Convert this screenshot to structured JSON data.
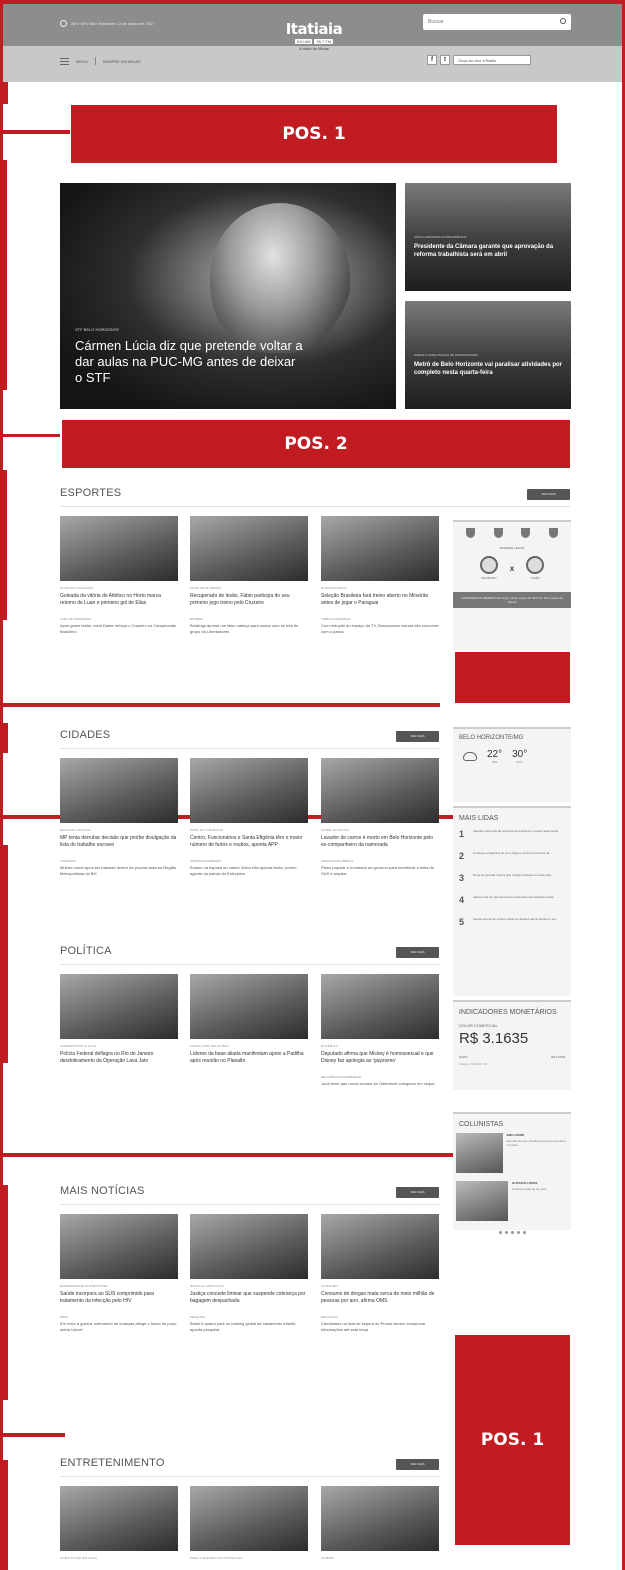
{
  "header": {
    "weather_text": "28°c 18°c Belo Horizonte 13 de março de 2017",
    "logo_name": "Itatiaia",
    "logo_freq_am": "610 AM",
    "logo_freq_fm": "95.7 FM",
    "logo_tagline": "A rádio de Minas",
    "search_placeholder": "Buscar",
    "menu_label": "MENU",
    "menu_link": "SEMPRE EM MINAS",
    "listen_label": "Ouça ao vivo a Rádio"
  },
  "ads": {
    "pos1_top": "POS. 1",
    "pos2": "POS. 2",
    "pos1_bottom": "POS. 1"
  },
  "hero": {
    "main_category": "STF BELO HORIZONTE",
    "main_title": "Cármen Lúcia diz que pretende voltar a dar aulas na PUC-MG antes de deixar o STF",
    "side": [
      {
        "category": "APÓS A REFORMA DA PREVIDÊNCIA",
        "title": "Presidente da Câmara garante que aprovação da reforma trabalhista será em abril"
      },
      {
        "category": "GREVE E PARALISAÇÃO DE PROFESSORES",
        "title": "Metrô de Belo Horizonte vai paralisar atividades por completo nesta quarta-feira"
      }
    ]
  },
  "esportes": {
    "title": "ESPORTES",
    "more": "VER MAIS",
    "cards": [
      {
        "cat": "ATLÉTICO GOLEADA",
        "title": "Goleada da vitória do Atlético no Horto marca retorno de Luan e primeiro gol de Elias",
        "cat2": "FLAG DE TRANSIÇÃO",
        "sub": "Após grave lesão, meia Dante reforça o Cruzeiro no Campeonato Brasileiro"
      },
      {
        "cat": "APÓS SETE MESES",
        "title": "Recuperado de lesão, Fábio participa do seu primeiro jogo treino pelo Cruzeiro",
        "cat2": "ESTREIA",
        "sub": "Botafogo aponta um falso cabeça para somar com os três do grupo da Libertadores"
      },
      {
        "cat": "ELIMINATÓRIAS",
        "title": "Seleção Brasileira fará treino aberto no Mineirão antes de jogar o Paraguai",
        "cat2": "TEMPO E MUDANÇA",
        "sub": "Com redução do espaço da TV, Bonsucesso estuda não concorrer com o passo"
      }
    ]
  },
  "cidades": {
    "title": "CIDADES",
    "more": "VER MAIS",
    "cards": [
      {
        "cat": "BARALHA JUDICIAL",
        "title": "MP tenta derrubar decisão que proíbe divulgação da lista do trabalho escravo",
        "cat2": "VIOLÊNCIA",
        "sub": "Mulher morre após ser baleada dentro da própria casa na Região Metropolitana de BH"
      },
      {
        "cat": "MAPA DA VIOLÊNCIA",
        "title": "Centro, Funcionários e Santa Efigênia têm o maior número de furtos e roubos, aponta APP",
        "cat2": "SUPOSTA AGRESSÃO",
        "sub": "Exame na esposa do cantor Victor não aponta lesão, porém agente da polícia do Entrepôvo"
      },
      {
        "cat": "CRIME NA DIVISA",
        "title": "Lavador de carros é morto em Belo Horizonte pelo ex-companheiro da namorada",
        "cat2": "ASSOCIAÇÃO MÉDICA",
        "sub": "Plano popular é mostrado ao governo para beneficiar a linha do SUS e ampliar"
      }
    ]
  },
  "politica": {
    "title": "POLÍTICA",
    "more": "VER MAIS",
    "cards": [
      {
        "cat": "SUBSIDIÁRIOS E ALVO",
        "title": "Polícia Federal deflagra no Rio de Janeiro desdobramento da Operação Lava Jato"
      },
      {
        "cat": "ACENO POR DELAÇÕES",
        "title": "Líderes da base aliada manifestam apoio a Padilha após reunião no Planalto"
      },
      {
        "cat": "POLÊMICA",
        "title": "Deputado afirma que Mickey é homossexual e que Disney faz apologia ao 'gayzismo'",
        "cat2": "DELAÇÕES DA ODEBRECHT",
        "sub": "Jucá teme que novos nomes da Odebrecht coloquem em xeque"
      }
    ]
  },
  "mais_noticias": {
    "title": "MAIS NOTÍCIAS",
    "more": "VER MAIS",
    "cards": [
      {
        "cat": "ENFERMIDADE DISPENSÁVEL",
        "title": "Saúde incorpora ao SUS comprimido para tratamento da infecção pelo HIV",
        "cat2": "SÍRIA",
        "sub": "Em meio à guerra, sofrimento de crianças atinge o fundo do poço, alerta Unicef"
      },
      {
        "cat": "NAVES E HABITAÇÃO",
        "title": "Justiça concede liminar que suspende cobrança por bagagem despachada",
        "cat2": "PESQUISA",
        "sub": "Brasil é quarto país no ranking global de casamento infantil, aponta pesquisa"
      },
      {
        "cat": "CONSUMO",
        "title": "Consumo de drogas mata cerca de meio milhão de pessoas por ano, afirma OMS",
        "cat2": "EDUCAÇÃO",
        "sub": "Candidatos na lista de espera do Prouni devem comprovar informações até esta terça"
      }
    ]
  },
  "entretenimento": {
    "title": "ENTRETENIMENTO",
    "more": "VER MAIS",
    "cards": [
      {
        "cat": "COMO FICAR EM CASA"
      },
      {
        "cat": "PARA A ALEGRIA DA CRIANÇADA"
      },
      {
        "cat": "CINEMA"
      }
    ]
  },
  "sidebar": {
    "match": {
      "info": "PREMIER LEGUE",
      "team_a": "CRUZEIRO",
      "team_b": "UNIÃO",
      "vs": "x",
      "foot": "CAMPEONATO MINEIRO Domingo, 19 de março de 2017 às 16h | Arena do Jacaré"
    },
    "weather": {
      "city": "BELO HORIZONTE/MG",
      "min": "22°",
      "max": "30°",
      "min_label": "MIN",
      "max_label": "MAX"
    },
    "mais_lidas": {
      "title": "MAIS LIDAS",
      "items": [
        {
          "n": "1",
          "t": "Solução para pais de crianças com autismo é pauta nesta sexta"
        },
        {
          "n": "2",
          "t": "Conheça a trajetória do Uno antigo e Gol do pra-frente 11"
        },
        {
          "n": "3",
          "t": "Nova temporada mostra que o Itaipu destaca a nossa raça"
        },
        {
          "n": "4",
          "t": "Atleta pode ser primeira para contar tudo nas histórias a fala"
        },
        {
          "n": "5",
          "t": "Vende acenar de sonhos cada ver desde Lula no Equipo e ver"
        }
      ]
    },
    "indicadores": {
      "title": "INDICADORES MONETÁRIOS",
      "label": "DÓLAR COMERCIAL",
      "value": "R$ 3.1635",
      "euro_label": "EURO",
      "euro_value": "R$ 3.3528",
      "note": "Cotação: 13/03/2017 18h"
    },
    "colunistas": {
      "title": "COLUNISTAS",
      "items": [
        {
          "name": "EMILI DORÉ",
          "text": "Há mais de três escolhas contra a América e Cruzeiro"
        },
        {
          "name": "GUSTAVO LOPES",
          "text": "O tempo anda de um jeito"
        }
      ]
    }
  }
}
